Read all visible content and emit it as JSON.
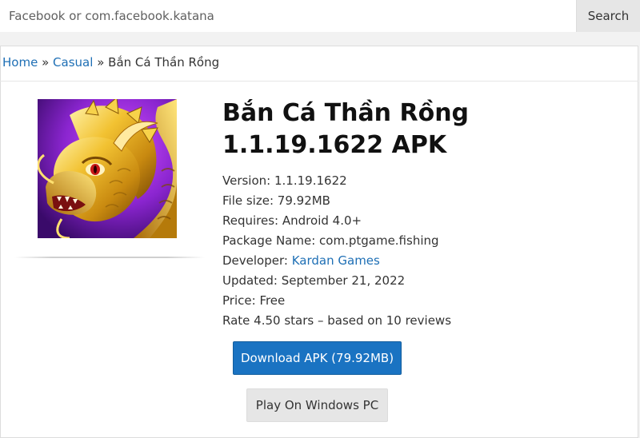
{
  "search": {
    "placeholder": "Facebook or com.facebook.katana",
    "button_label": "Search"
  },
  "breadcrumb": {
    "home": "Home",
    "separator": "»",
    "category": "Casual",
    "current": "Bắn Cá Thần Rồng"
  },
  "app": {
    "title": "Bắn Cá Thần Rồng 1.1.19.1622 APK",
    "icon": "golden-dragon-app-icon",
    "meta": {
      "version_label": "Version:",
      "version": "1.1.19.1622",
      "file_size_label": "File size:",
      "file_size": "79.92MB",
      "requires_label": "Requires:",
      "requires": "Android 4.0+",
      "package_label": "Package Name:",
      "package": "com.ptgame.fishing",
      "developer_label": "Developer:",
      "developer": "Kardan Games",
      "updated_label": "Updated:",
      "updated": "September 21, 2022",
      "price_label": "Price:",
      "price": "Free",
      "rate_text": "Rate 4.50 stars – based on 10 reviews"
    }
  },
  "buttons": {
    "download": "Download APK (79.92MB)",
    "pc": "Play On Windows PC"
  },
  "colors": {
    "link": "#1e6fb5",
    "primary_button": "#1a73c2",
    "secondary_button": "#e6e6e6",
    "icon_background": "#7b22c9",
    "icon_gold": "#e0a91a"
  }
}
